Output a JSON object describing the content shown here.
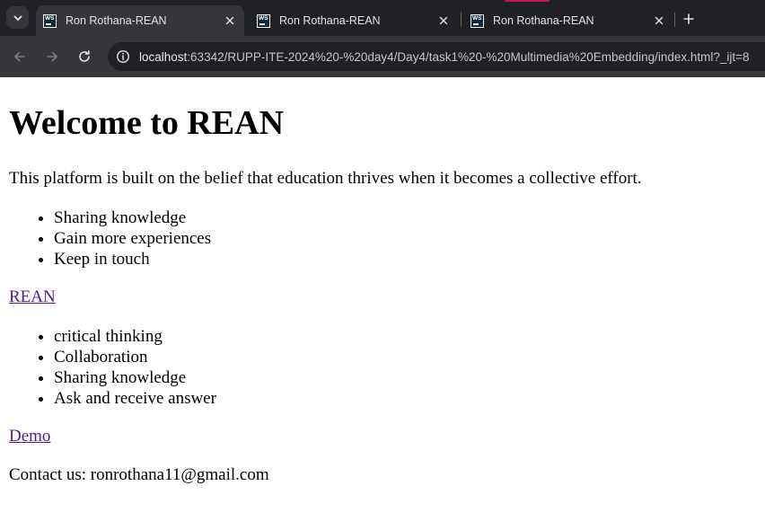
{
  "browser": {
    "tabs": [
      {
        "title": "Ron Rothana-REAN",
        "active": true,
        "favicon": "webstorm-icon"
      },
      {
        "title": "Ron Rothana-REAN",
        "active": false,
        "favicon": "webstorm-icon"
      },
      {
        "title": "Ron Rothana-REAN",
        "active": false,
        "favicon": "webstorm-icon"
      }
    ],
    "favicon_text": "WS",
    "url_host": "localhost",
    "url_path": ":63342/RUPP-ITE-2024%20-%20day4/Day4/task1%20-%20Multimedia%20Embedding/index.html?_ijt=8",
    "colors": {
      "tabstrip": "#202124",
      "toolbar": "#35363a",
      "omnibox": "#202124",
      "accent_pink": "#c2185b"
    }
  },
  "page": {
    "heading": "Welcome to REAN",
    "intro": "This platform is built on the belief that education thrives when it becomes a collective effort.",
    "list1": [
      "Sharing knowledge",
      "Gain more experiences",
      "Keep in touch"
    ],
    "link1": "REAN",
    "list2": [
      "critical thinking",
      "Collaboration",
      "Sharing knowledge",
      "Ask and receive answer"
    ],
    "link2": "Demo",
    "contact": "Contact us: ronrothana11@gmail.com",
    "link_color": "#551a8b"
  }
}
